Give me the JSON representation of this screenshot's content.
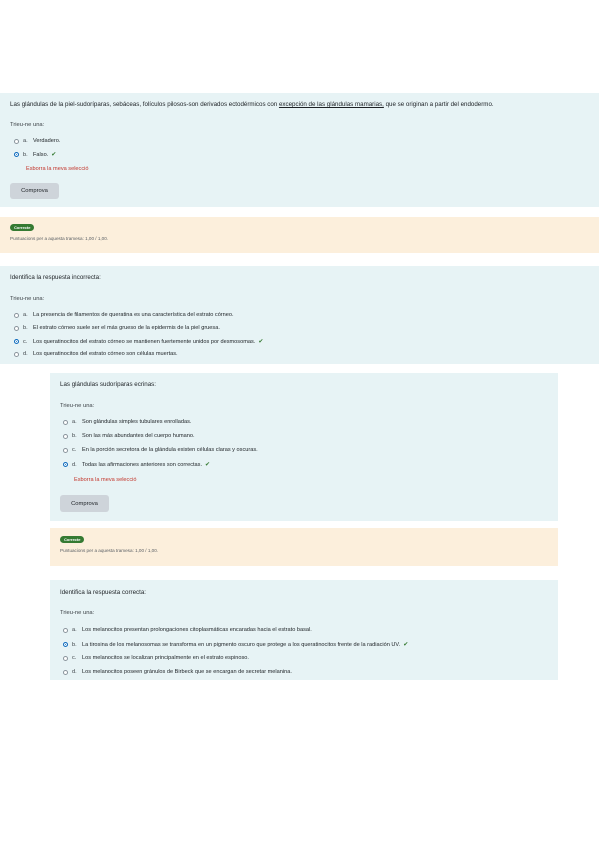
{
  "q1": {
    "text_before": "Las glándulas de la piel-sudoríparas, sebáceas, folículos pilosos-son derivados ectodérmicos con ",
    "text_underlined": "excepción de las glándulas mamarias,",
    "text_after": " que se originan a partir del endodermo.",
    "prompt": "Trieu-ne una:",
    "options": [
      {
        "letter": "a.",
        "text": "Verdadero."
      },
      {
        "letter": "b.",
        "text": "Falso."
      }
    ],
    "clear_label": "Esborra la meva selecció",
    "check_label": "Comprova"
  },
  "fb1": {
    "badge": "Correcte",
    "score": "Puntuacions per a aquesta tramesa: 1,00 / 1,00."
  },
  "q2": {
    "text": "Identifica la respuesta incorrecta:",
    "prompt": "Trieu-ne una:",
    "options": [
      {
        "letter": "a.",
        "text": "La presencia de filamentos de queratina es una característica del estrato córneo."
      },
      {
        "letter": "b.",
        "text": "El estrato córneo suele ser el más grueso de la epidermis de la piel gruesa."
      },
      {
        "letter": "c.",
        "text": "Los queratinocitos del estrato córneo se mantienen fuertemente unidos por desmosomas."
      },
      {
        "letter": "d.",
        "text": "Los queratinocitos del estrato córneo son células muertas."
      }
    ]
  },
  "q3": {
    "text": "Las glándulas sudoríparas ecrinas:",
    "prompt": "Trieu-ne una:",
    "options": [
      {
        "letter": "a.",
        "text": "Son glándulas simples tubulares enrolladas."
      },
      {
        "letter": "b.",
        "text": "Son las más abundantes del cuerpo humano."
      },
      {
        "letter": "c.",
        "text": "En la porción secretora de la glándula existen células claras y oscuras."
      },
      {
        "letter": "d.",
        "text": "Todas las afirmaciones anteriores son correctas."
      }
    ],
    "clear_label": "Esborra la meva selecció",
    "check_label": "Comprova"
  },
  "fb2": {
    "badge": "Correcte",
    "score": "Puntuacions per a aquesta tramesa: 1,00 / 1,00."
  },
  "q4": {
    "text": "Identifica la respuesta correcta:",
    "prompt": "Trieu-ne una:",
    "options": [
      {
        "letter": "a.",
        "text": "Los melanocitos presentan prolongaciones citoplasmáticas encaradas hacia el estrato basal."
      },
      {
        "letter": "b.",
        "text": "La tirosina de los melanosomas se transforma en un pigmento oscuro que protege a los queratinocitos frente de la radiación UV."
      },
      {
        "letter": "c.",
        "text": "Los melanocitos se localizan principalmente en el estrato espinoso."
      },
      {
        "letter": "d.",
        "text": "Los melanocitos poseen gránulos de Birbeck que se encargan de secretar melanina."
      }
    ]
  },
  "colors": {
    "question_bg": "#e7f3f5",
    "feedback_bg": "#fcefdc",
    "selected": "#0f6cbf",
    "correct": "#357a32",
    "clear_link": "#c3342a"
  }
}
